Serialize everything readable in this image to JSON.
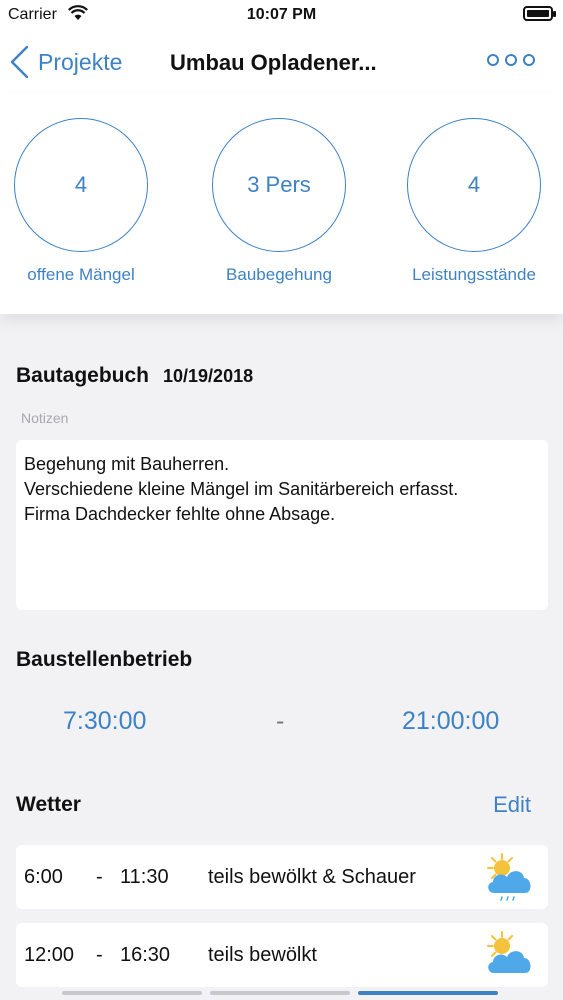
{
  "status": {
    "carrier": "Carrier",
    "time": "10:07 PM"
  },
  "nav": {
    "back_label": "Projekte",
    "title": "Umbau Opladener..."
  },
  "stats": [
    {
      "value": "4",
      "label": "offene Mängel"
    },
    {
      "value": "3 Pers",
      "label": "Baubegehung"
    },
    {
      "value": "4",
      "label": "Leistungsstände"
    }
  ],
  "diary": {
    "title": "Bautagebuch",
    "date": "10/19/2018",
    "notes_label": "Notizen",
    "notes": [
      "Begehung mit Bauherren.",
      "Verschiedene kleine Mängel im Sanitärbereich erfasst.",
      "Firma Dachdecker fehlte ohne Absage."
    ]
  },
  "operation": {
    "title": "Baustellenbetrieb",
    "from": "7:30:00",
    "separator": "-",
    "to": "21:00:00"
  },
  "weather": {
    "title": "Wetter",
    "edit_label": "Edit",
    "rows": [
      {
        "from": "6:00",
        "dash": "-",
        "to": "11:30",
        "desc": "teils bewölkt & Schauer",
        "icon": "sun-cloud-rain-icon"
      },
      {
        "from": "12:00",
        "dash": "-",
        "to": "16:30",
        "desc": "teils bewölkt",
        "icon": "sun-cloud-icon"
      }
    ]
  },
  "colors": {
    "accent": "#3d82c4",
    "background": "#f2f2f4",
    "sun": "#f5c33b",
    "cloud": "#4fa8e8"
  },
  "page_indicator": {
    "pages": 3,
    "active": 3
  }
}
